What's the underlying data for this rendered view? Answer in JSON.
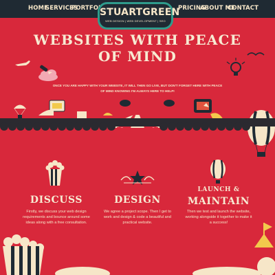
{
  "nav": {
    "left": [
      "HOME",
      "SERVICES",
      "PORTFOLIO"
    ],
    "right": [
      "PRICING",
      "ABOUT ME",
      "CONTACT"
    ]
  },
  "logo": {
    "title": "STUARTGREEN",
    "subtitle": "WEB DESIGN | WEB DEVELOPMENT | SEO"
  },
  "hero": {
    "headline_line1": "WEBSITES WITH PEACE",
    "headline_line2": "OF MIND",
    "subtext_line1": "ONCE YOU ARE HAPPY WITH YOUR WEBSITE, IT WILL THEN GO LIVE, BUT DON'T FORGET HERE WITH PEACE",
    "subtext_line2": "OF MIND KNOWING I'M ALWAYS HERE TO HELP!"
  },
  "services": [
    {
      "title": "DISCUSS",
      "title_small": "",
      "text": "Firstly, we discuss your web design requirements and bounce around some ideas along with a free consultation."
    },
    {
      "title": "DESIGN",
      "title_small": "",
      "text": "We agree a project scope. Then I get to work and design & code a beautiful and practical website."
    },
    {
      "title": "MAINTAIN",
      "title_small": "LAUNCH &",
      "text": "Then we test and launch the website, working alongside it together to make it a success!"
    }
  ],
  "colors": {
    "background": "#d8283b",
    "nav_dark": "#1f2a33",
    "cream": "#f6e6c8",
    "teal": "#2f9c8c"
  }
}
